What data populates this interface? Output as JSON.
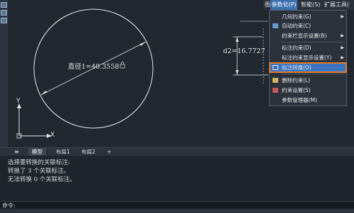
{
  "menubar": {
    "items": [
      {
        "label": "图(V)"
      },
      {
        "label": "参数化(P)"
      },
      {
        "label": "智能(S)"
      },
      {
        "label": "扩展工具("
      }
    ]
  },
  "dropdown": {
    "items": [
      {
        "label": "几何约束(G)",
        "submenu": true
      },
      {
        "label": "自动约束(C)",
        "submenu": false
      },
      {
        "label": "约束栏显示设置(B)",
        "submenu": true
      },
      {
        "label": "标注约束(D)",
        "submenu": true
      },
      {
        "label": "标注约束显示设置(Y)",
        "submenu": true
      },
      {
        "label": "标注转换(O)",
        "submenu": false,
        "highlighted": true
      },
      {
        "label": "删除约束(L)",
        "submenu": false
      },
      {
        "label": "约束设置(S)",
        "submenu": false
      },
      {
        "label": "参数管理器(M)",
        "submenu": false
      }
    ]
  },
  "drawing": {
    "circle_dim_label": "直径1=40.3558",
    "d2_label": "d2=16.7727",
    "axis_x": "X",
    "axis_y": "Y"
  },
  "tabs": {
    "model": "模型",
    "layout1": "布局1",
    "layout2": "布局2",
    "add": "+"
  },
  "command": {
    "lines": [
      "选择要转换的关联标注:",
      "转换了 3 个关联标注。",
      "无法转换 0 个关联标注。"
    ],
    "prompt": "命令:"
  },
  "colors": {
    "highlight": "#3c74c2",
    "highlight_border": "#e07d2c",
    "background": "#212830"
  }
}
